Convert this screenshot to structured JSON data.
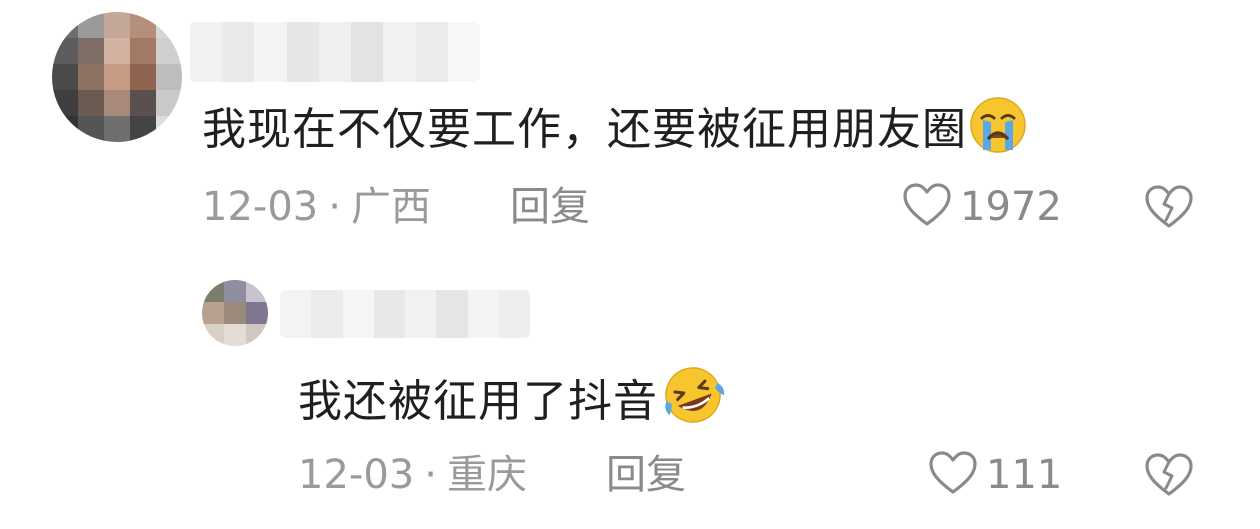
{
  "comments": [
    {
      "text": "我现在不仅要工作，还要被征用朋友圈",
      "emoji": "loudly-crying-face",
      "date": "12-03",
      "separator": "·",
      "location": "广西",
      "reply_label": "回复",
      "likes": "1972"
    },
    {
      "text": "我还被征用了抖音",
      "emoji": "rolling-on-floor-laughing",
      "date": "12-03",
      "separator": "·",
      "location": "重庆",
      "reply_label": "回复",
      "likes": "111"
    }
  ],
  "colors": {
    "text": "#1f1f1f",
    "meta": "#9a9a9a",
    "icon": "#8a8a8a",
    "emoji_yellow": "#f7c62f",
    "emoji_tear": "#5aa9e6"
  }
}
